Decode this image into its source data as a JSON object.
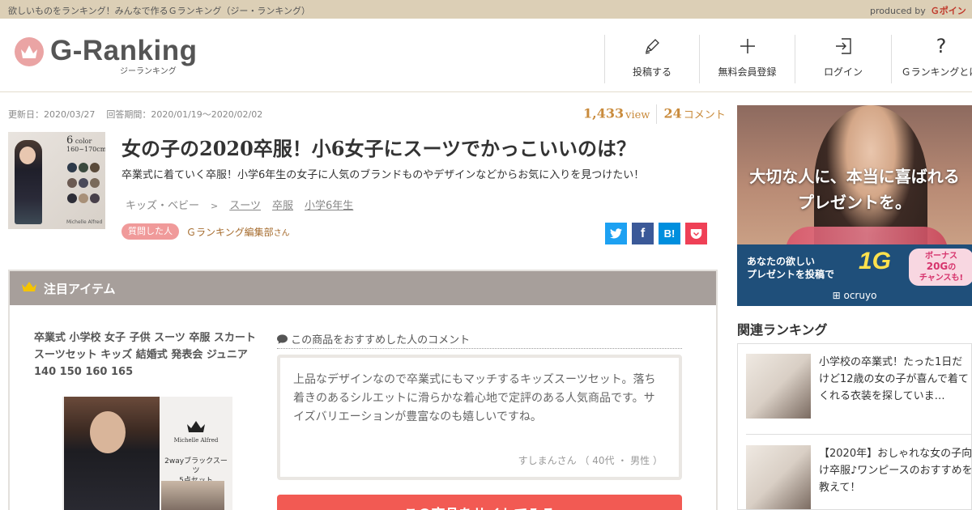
{
  "topbar": {
    "tagline": "欲しいものをランキング！みんなで作るＧランキング（ジー・ランキング）",
    "produced_by": "produced by",
    "gpoint": "Ｇポイン"
  },
  "header": {
    "logo_text": "G-Ranking",
    "logo_sub": "ジーランキング",
    "nav": [
      {
        "label": "投稿する",
        "icon": "pen-icon"
      },
      {
        "label": "無料会員登録",
        "icon": "plus-icon"
      },
      {
        "label": "ログイン",
        "icon": "login-icon"
      },
      {
        "label": "Ｇランキングとは",
        "icon": "question-icon"
      }
    ]
  },
  "meta": {
    "updated": "更新日：2020/03/27",
    "period": "回答期間：2020/01/19～2020/02/02"
  },
  "stats": {
    "views": "1,433",
    "views_unit": "view",
    "comments": "24",
    "comments_unit": "コメント"
  },
  "thumb": {
    "color_count": "6",
    "color_label": "color",
    "size_range": "160~170cm",
    "caption": "Michelle Alfred",
    "swatch_colors": [
      "#2d3a4a",
      "#3b4a3e",
      "#5a4a3a",
      "#6b5a52",
      "#4a4a5a",
      "#7a6a5a",
      "#2e2e38",
      "#a89078",
      "#48404a"
    ]
  },
  "question": {
    "title": "女の子の2020卒服！小6女子にスーツでかっこいいのは？",
    "description": "卒業式に着ていく卒服！小学6年生の女子に人気のブランドものやデザインなどからお気に入りを見つけたい！",
    "category": "キッズ・ベビー",
    "category_arrow": ">",
    "tags": [
      "スーツ",
      "卒服",
      "小学6年生"
    ],
    "asker_badge": "質問した人",
    "asker_name": "Ｇランキング編集部",
    "asker_suffix": "さん"
  },
  "share": {
    "colors": {
      "twitter": "#1da1f2",
      "facebook": "#3b5998",
      "hatena": "#008fde",
      "pocket": "#ef4056"
    },
    "hatena_label": "B!"
  },
  "featured": {
    "heading": "注目アイテム",
    "product_name": "卒業式 小学校 女子 子供 スーツ 卒服 スカートスーツセット キッズ 結婚式 発表会 ジュニア 140 150 160 165",
    "image_brand": "Michelle Alfred",
    "image_label": "2wayブラックスーツ",
    "image_set": "5点セット",
    "comment_heading": "この商品をおすすめした人のコメント",
    "comment": "上品なデザインなので卒業式にもマッチするキッズスーツセット。落ち着きのあるシルエットに滑らかな着心地で定評のある人気商品です。サイズバリエーションが豊富なのも嬉しいですね。",
    "comment_author": "すしまんさん （ 40代 ・ 男性 ）",
    "cta": "この商品をサイトでみる"
  },
  "ad": {
    "headline1": "大切な人に、本当に喜ばれる",
    "headline2": "プレゼントを。",
    "line1": "あなたの欲しい",
    "line2": "プレゼントを投稿で",
    "highlight": "1G",
    "bonus1": "ボーナス",
    "bonus2": "20G",
    "bonus3": "の",
    "bonus4": "チャンスも!",
    "brand": "ocruyo"
  },
  "related": {
    "title": "関連ランキング",
    "items": [
      {
        "text": "小学校の卒業式！たった1日だけど12歳の女の子が喜んで着てくれる衣装を探していま…"
      },
      {
        "text": "【2020年】おしゃれな女の子向け卒服♪ワンピースのおすすめを教えて！"
      }
    ]
  }
}
